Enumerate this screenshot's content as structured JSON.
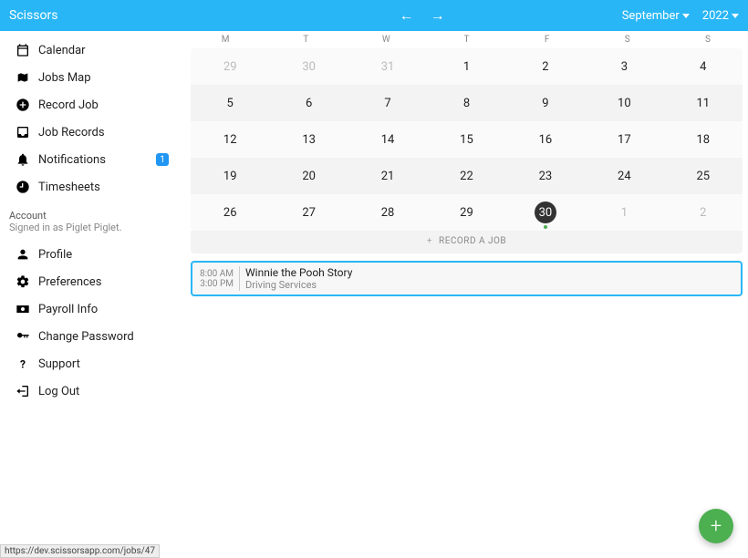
{
  "header": {
    "brand": "Scissors",
    "month_label": "September",
    "year_label": "2022"
  },
  "sidebar": {
    "main_items": [
      {
        "label": "Calendar",
        "icon": "calendar-icon",
        "badge": null
      },
      {
        "label": "Jobs Map",
        "icon": "map-icon",
        "badge": null
      },
      {
        "label": "Record Job",
        "icon": "plus-circle-icon",
        "badge": null
      },
      {
        "label": "Job Records",
        "icon": "inbox-icon",
        "badge": null
      },
      {
        "label": "Notifications",
        "icon": "bell-icon",
        "badge": "1"
      },
      {
        "label": "Timesheets",
        "icon": "clock-icon",
        "badge": null
      }
    ],
    "account_header": "Account",
    "account_sub": "Signed in as Piglet Piglet.",
    "account_items": [
      {
        "label": "Profile",
        "icon": "person-icon"
      },
      {
        "label": "Preferences",
        "icon": "gear-icon"
      },
      {
        "label": "Payroll Info",
        "icon": "cash-icon"
      },
      {
        "label": "Change Password",
        "icon": "key-icon"
      },
      {
        "label": "Support",
        "icon": "question-icon"
      },
      {
        "label": "Log Out",
        "icon": "logout-icon"
      }
    ]
  },
  "calendar": {
    "day_headers": [
      "M",
      "T",
      "W",
      "T",
      "F",
      "S",
      "S"
    ],
    "rows": [
      [
        {
          "n": "29",
          "outside": true
        },
        {
          "n": "30",
          "outside": true
        },
        {
          "n": "31",
          "outside": true
        },
        {
          "n": "1"
        },
        {
          "n": "2"
        },
        {
          "n": "3"
        },
        {
          "n": "4"
        }
      ],
      [
        {
          "n": "5"
        },
        {
          "n": "6"
        },
        {
          "n": "7"
        },
        {
          "n": "8"
        },
        {
          "n": "9"
        },
        {
          "n": "10"
        },
        {
          "n": "11"
        }
      ],
      [
        {
          "n": "12"
        },
        {
          "n": "13"
        },
        {
          "n": "14"
        },
        {
          "n": "15"
        },
        {
          "n": "16"
        },
        {
          "n": "17"
        },
        {
          "n": "18"
        }
      ],
      [
        {
          "n": "19"
        },
        {
          "n": "20"
        },
        {
          "n": "21"
        },
        {
          "n": "22"
        },
        {
          "n": "23"
        },
        {
          "n": "24"
        },
        {
          "n": "25"
        }
      ],
      [
        {
          "n": "26"
        },
        {
          "n": "27"
        },
        {
          "n": "28"
        },
        {
          "n": "29"
        },
        {
          "n": "30",
          "selected": true,
          "dot": true
        },
        {
          "n": "1",
          "outside": true
        },
        {
          "n": "2",
          "outside": true
        }
      ]
    ],
    "record_btn": "RECORD A JOB"
  },
  "job": {
    "start": "8:00 AM",
    "end": "3:00 PM",
    "title": "Winnie the Pooh Story",
    "subtitle": "Driving Services"
  },
  "statusbar": "https://dev.scissorsapp.com/jobs/47"
}
